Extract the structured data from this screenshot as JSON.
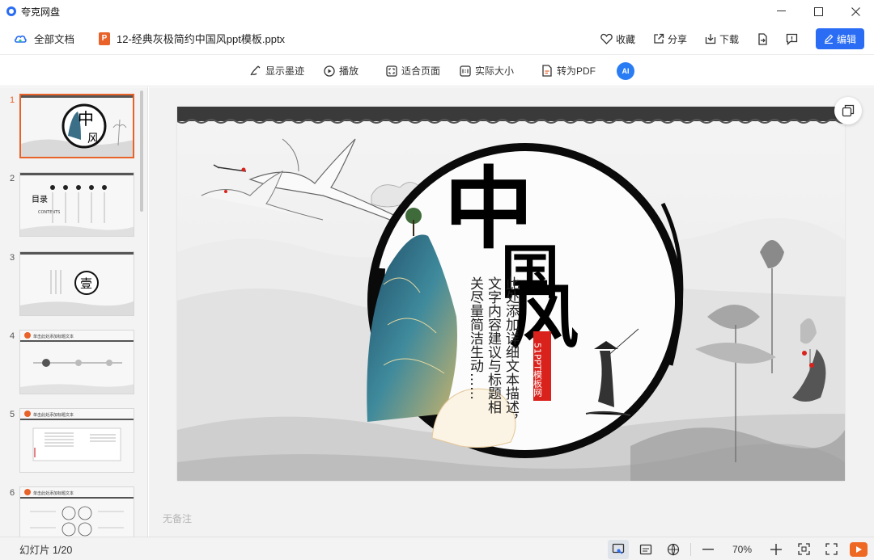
{
  "app": {
    "title": "夸克网盘"
  },
  "window_controls": {
    "minimize": "—",
    "maximize": "☐",
    "close": "✕"
  },
  "header": {
    "all_docs": "全部文档",
    "file_badge": "P",
    "filename": "12-经典灰极简约中国风ppt模板.pptx",
    "favorite": "收藏",
    "share": "分享",
    "download": "下载",
    "edit": "编辑"
  },
  "toolbar": {
    "show_ink": "显示墨迹",
    "play": "播放",
    "fit_page": "适合页面",
    "actual_size": "实际大小",
    "to_pdf": "转为PDF",
    "ai": "AI"
  },
  "sidebar": {
    "thumbnails": [
      {
        "num": "1",
        "active": true
      },
      {
        "num": "2",
        "active": false
      },
      {
        "num": "3",
        "active": false
      },
      {
        "num": "4",
        "active": false
      },
      {
        "num": "5",
        "active": false
      },
      {
        "num": "6",
        "active": false
      }
    ],
    "thumb2": {
      "title": "目录",
      "subtitle": "CONTENTS"
    },
    "thumb3": {
      "glyph": "壹"
    },
    "thumb_header_text": "单击此处添加标题文本"
  },
  "slide": {
    "big_char_1": "中",
    "big_char_2": "国",
    "big_char_3": "风",
    "seal": "51PPT模板网",
    "vertical_text_1": "此处添加详细文本描述，",
    "vertical_text_2": "文字内容建议与标题相",
    "vertical_text_3": "关尽量简洁生动……"
  },
  "notes": {
    "placeholder": "无备注"
  },
  "status": {
    "slide_count": "幻灯片 1/20",
    "zoom": "70%"
  },
  "colors": {
    "accent": "#2a6df4",
    "ppt_orange": "#e8622a",
    "seal_red": "#d9221c"
  }
}
